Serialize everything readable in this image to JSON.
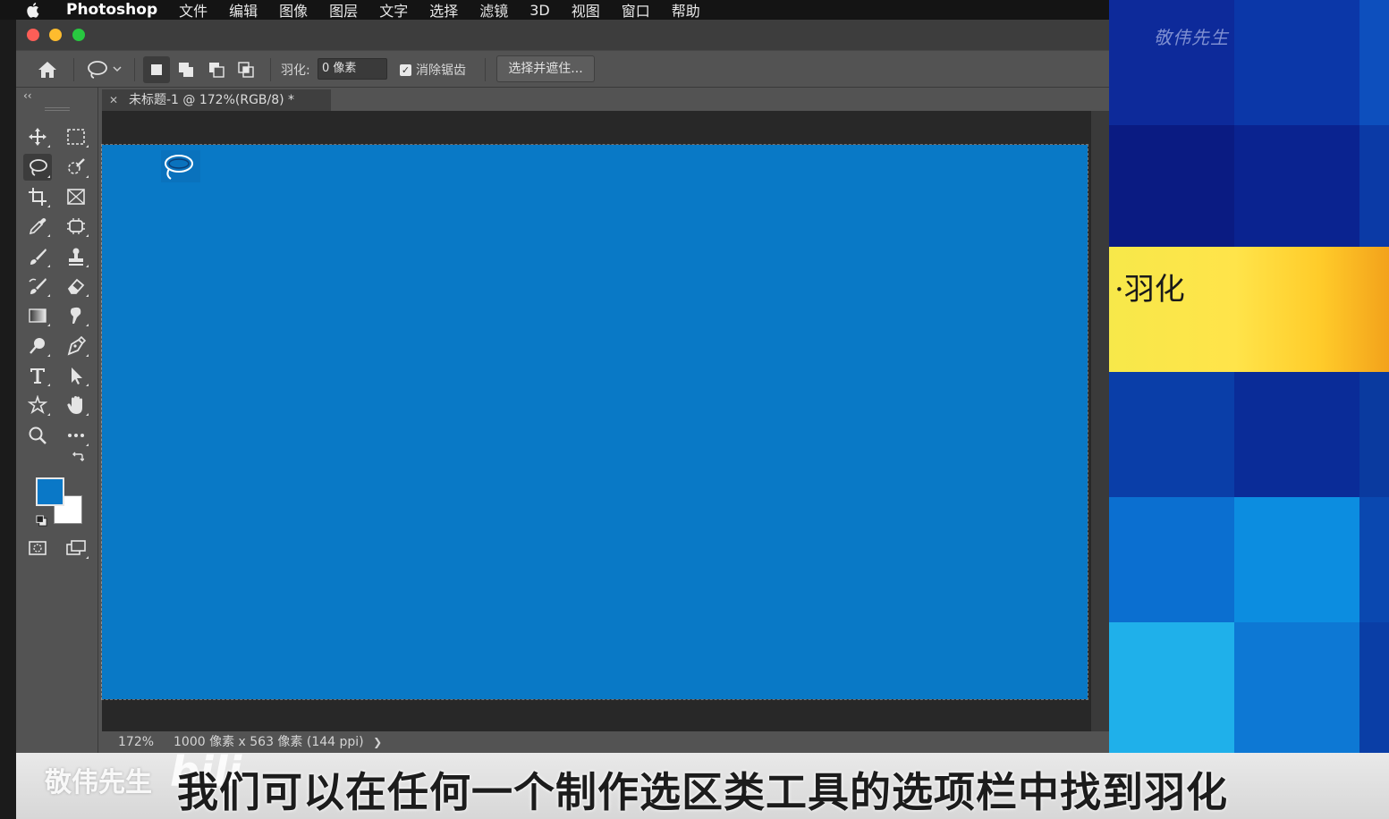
{
  "menubar": {
    "app_name": "Photoshop",
    "items": [
      "文件",
      "编辑",
      "图像",
      "图层",
      "文字",
      "选择",
      "滤镜",
      "3D",
      "视图",
      "窗口",
      "帮助"
    ]
  },
  "options_bar": {
    "feather_label": "羽化:",
    "feather_value": "0 像素",
    "anti_alias_label": "消除锯齿",
    "anti_alias_checked": true,
    "select_mask_label": "选择并遮住..."
  },
  "document": {
    "tab_title": "未标题-1 @ 172%(RGB/8) *",
    "canvas_color": "#0979c6"
  },
  "status_bar": {
    "zoom": "172%",
    "doc_size": "1000 像素 x 563 像素 (144 ppi)",
    "arrow": "❯"
  },
  "toolbar": {
    "collapse_glyph": "‹‹",
    "foreground_color": "#0a78c7",
    "background_color": "#ffffff"
  },
  "right_panel": {
    "watermark": "敬伟先生",
    "label": "·羽化"
  },
  "subtitle_strip": {
    "watermark": "敬伟先生",
    "bili_mark": "bili",
    "text": "我们可以在任何一个制作选区类工具的选项栏中找到羽化"
  }
}
